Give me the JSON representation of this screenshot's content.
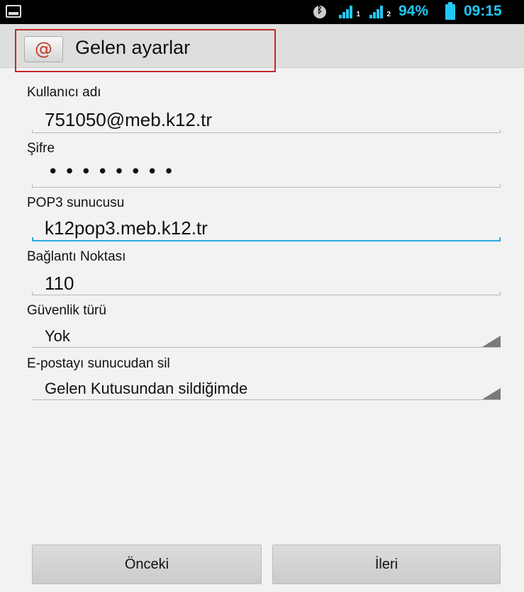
{
  "status_bar": {
    "battery_percent": "94%",
    "time": "09:15",
    "accent_color": "#21c8f6",
    "icons": [
      "screenshot-icon",
      "bluetooth-icon",
      "signal-sim1-icon",
      "signal-sim2-icon",
      "battery-icon"
    ],
    "sim1_label": "1",
    "sim2_label": "2"
  },
  "header": {
    "title": "Gelen ayarlar",
    "icon_glyph": "@"
  },
  "form": {
    "username": {
      "label": "Kullanıcı adı",
      "value": "751050@meb.k12.tr"
    },
    "password": {
      "label": "Şifre",
      "value": "••••••••"
    },
    "pop3_server": {
      "label": "POP3 sunucusu",
      "value": "k12pop3.meb.k12.tr"
    },
    "port": {
      "label": "Bağlantı Noktası",
      "value": "110"
    },
    "security_type": {
      "label": "Güvenlik türü",
      "selected": "Yok"
    },
    "delete_from_server": {
      "label": "E-postayı sunucudan sil",
      "selected": "Gelen Kutusundan sildiğimde"
    }
  },
  "buttons": {
    "previous": "Önceki",
    "next": "İleri"
  }
}
